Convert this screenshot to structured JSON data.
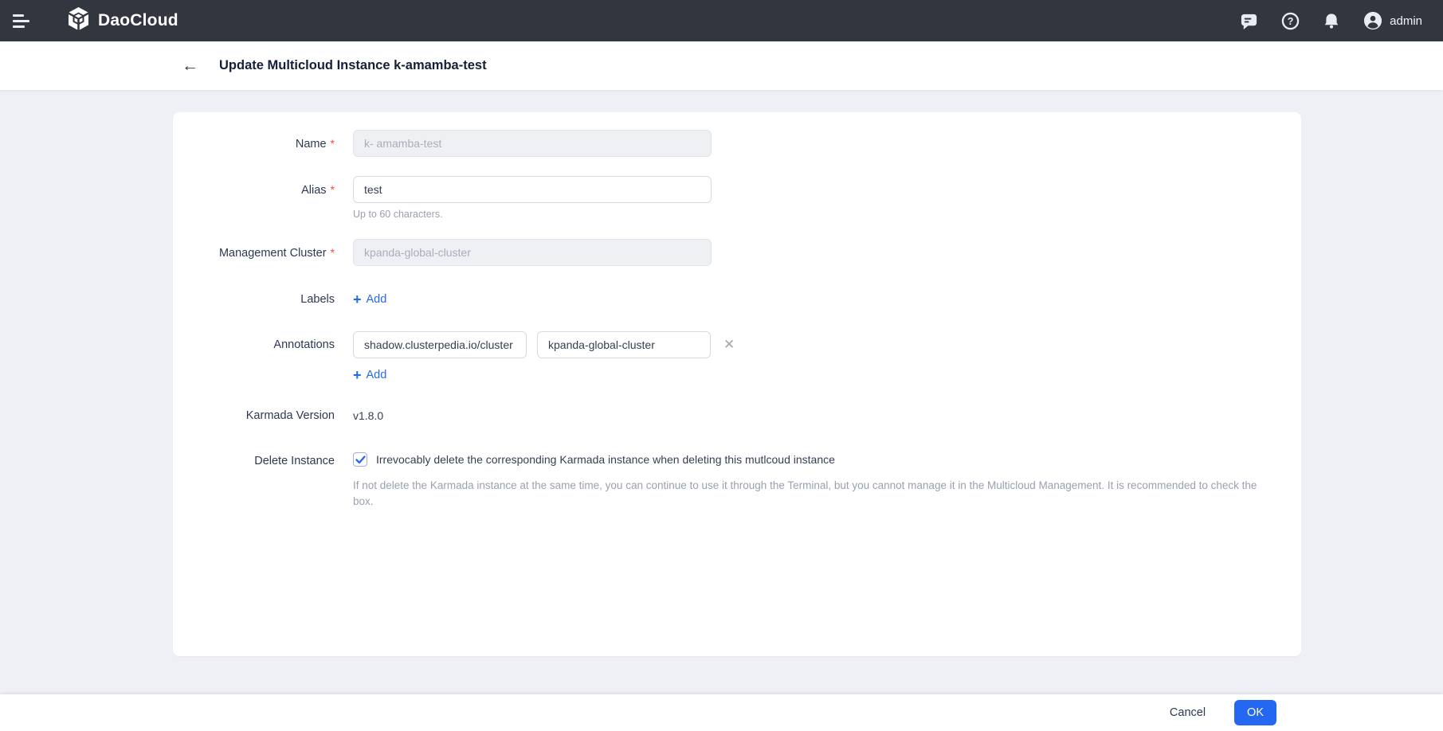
{
  "topbar": {
    "brand": "DaoCloud",
    "user": "admin"
  },
  "header": {
    "title": "Update Multicloud Instance k-amamba-test"
  },
  "form": {
    "required_marker": "*",
    "name": {
      "label": "Name",
      "value": "k- amamba-test",
      "disabled": true
    },
    "alias": {
      "label": "Alias",
      "value": "test",
      "help": "Up to 60 characters."
    },
    "management_cluster": {
      "label": "Management Cluster",
      "value": "kpanda-global-cluster",
      "disabled": true
    },
    "labels": {
      "label": "Labels",
      "add": "Add"
    },
    "annotations": {
      "label": "Annotations",
      "key": "shadow.clusterpedia.io/cluster",
      "value": "kpanda-global-cluster",
      "add": "Add",
      "remove_glyph": "✕"
    },
    "karmada_version": {
      "label": "Karmada Version",
      "value": "v1.8.0"
    },
    "delete_instance": {
      "label": "Delete Instance",
      "checked": true,
      "checkbox_label": "Irrevocably delete the corresponding Karmada instance when deleting this mutlcoud instance",
      "help": "If not delete the Karmada instance at the same time, you can continue to use it through the Terminal, but you cannot manage it in the Multicloud Management. It is recommended to check the box."
    }
  },
  "footer": {
    "cancel": "Cancel",
    "ok": "OK"
  },
  "icons": {
    "menu": "hamburger-menu",
    "brand_logo": "daocloud-cube",
    "message": "message-bubble",
    "help": "question-circle",
    "notifications": "bell",
    "user": "person-circle",
    "back": "left-arrow",
    "add": "+",
    "check": "checkmark"
  },
  "colors": {
    "topbar_bg": "#32363f",
    "accent": "#2468f2",
    "required": "#f2494a",
    "page_bg": "#eef0f5"
  }
}
